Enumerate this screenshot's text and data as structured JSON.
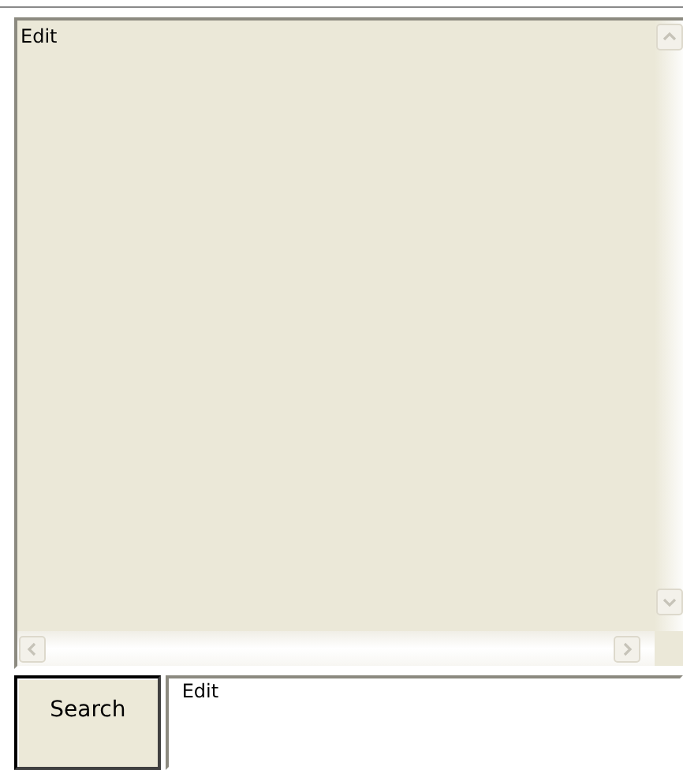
{
  "output": {
    "value": "Edit",
    "disabled": true
  },
  "search_button": {
    "label": "Search"
  },
  "query": {
    "value": "Edit"
  }
}
